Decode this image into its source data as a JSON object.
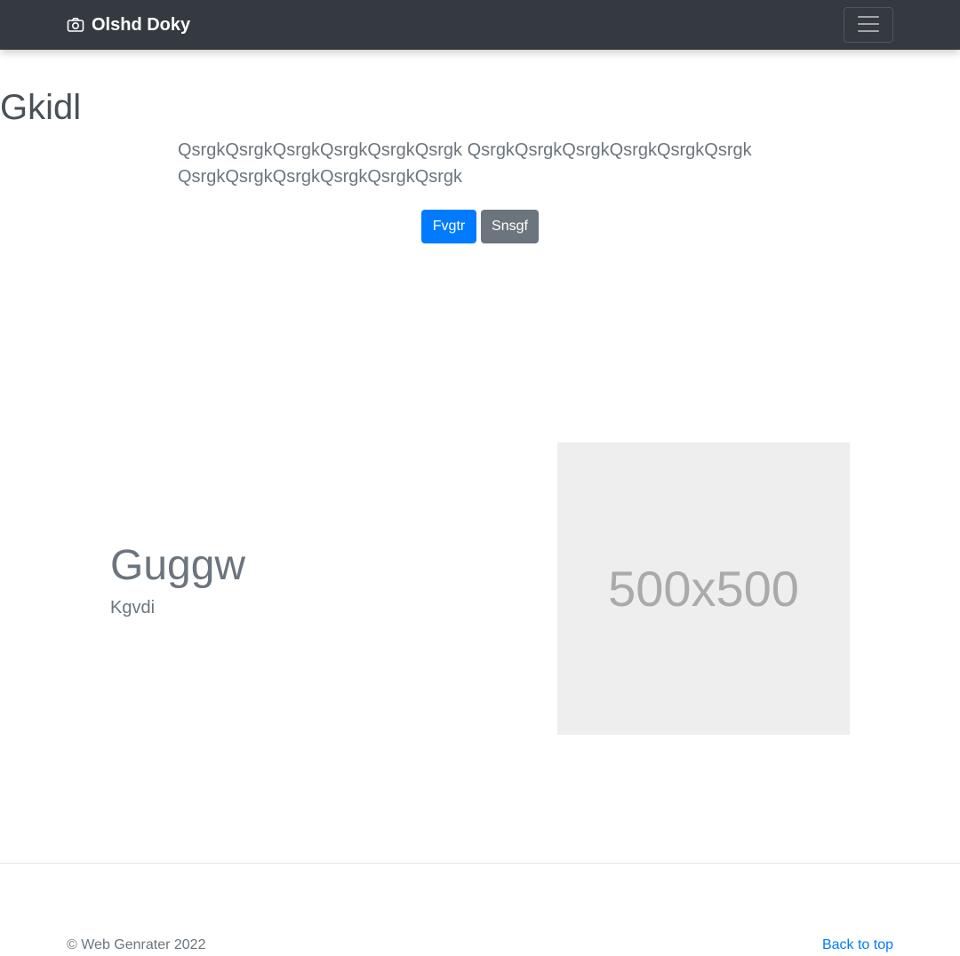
{
  "navbar": {
    "brand_icon": "camera-icon",
    "brand_label": "Olshd Doky",
    "toggler_icon": "hamburger-menu-icon",
    "background": "#343a40"
  },
  "hero": {
    "title": "Gkidl",
    "lead": "QsrgkQsrgkQsrgkQsrgkQsrgkQsrgk QsrgkQsrgkQsrgkQsrgkQsrgkQsrgk QsrgkQsrgkQsrgkQsrgkQsrgkQsrgk",
    "primary_button": "Fvgtr",
    "secondary_button": "Snsgf"
  },
  "feature": {
    "heading": "Guggw",
    "subheading": "Kgvdi",
    "image_placeholder": "500x500"
  },
  "footer": {
    "copyright": "© Web Genrater 2022",
    "back_to_top": "Back to top"
  },
  "colors": {
    "primary": "#007bff",
    "secondary": "#6c757d",
    "placeholder_bg": "#eeeeee"
  }
}
